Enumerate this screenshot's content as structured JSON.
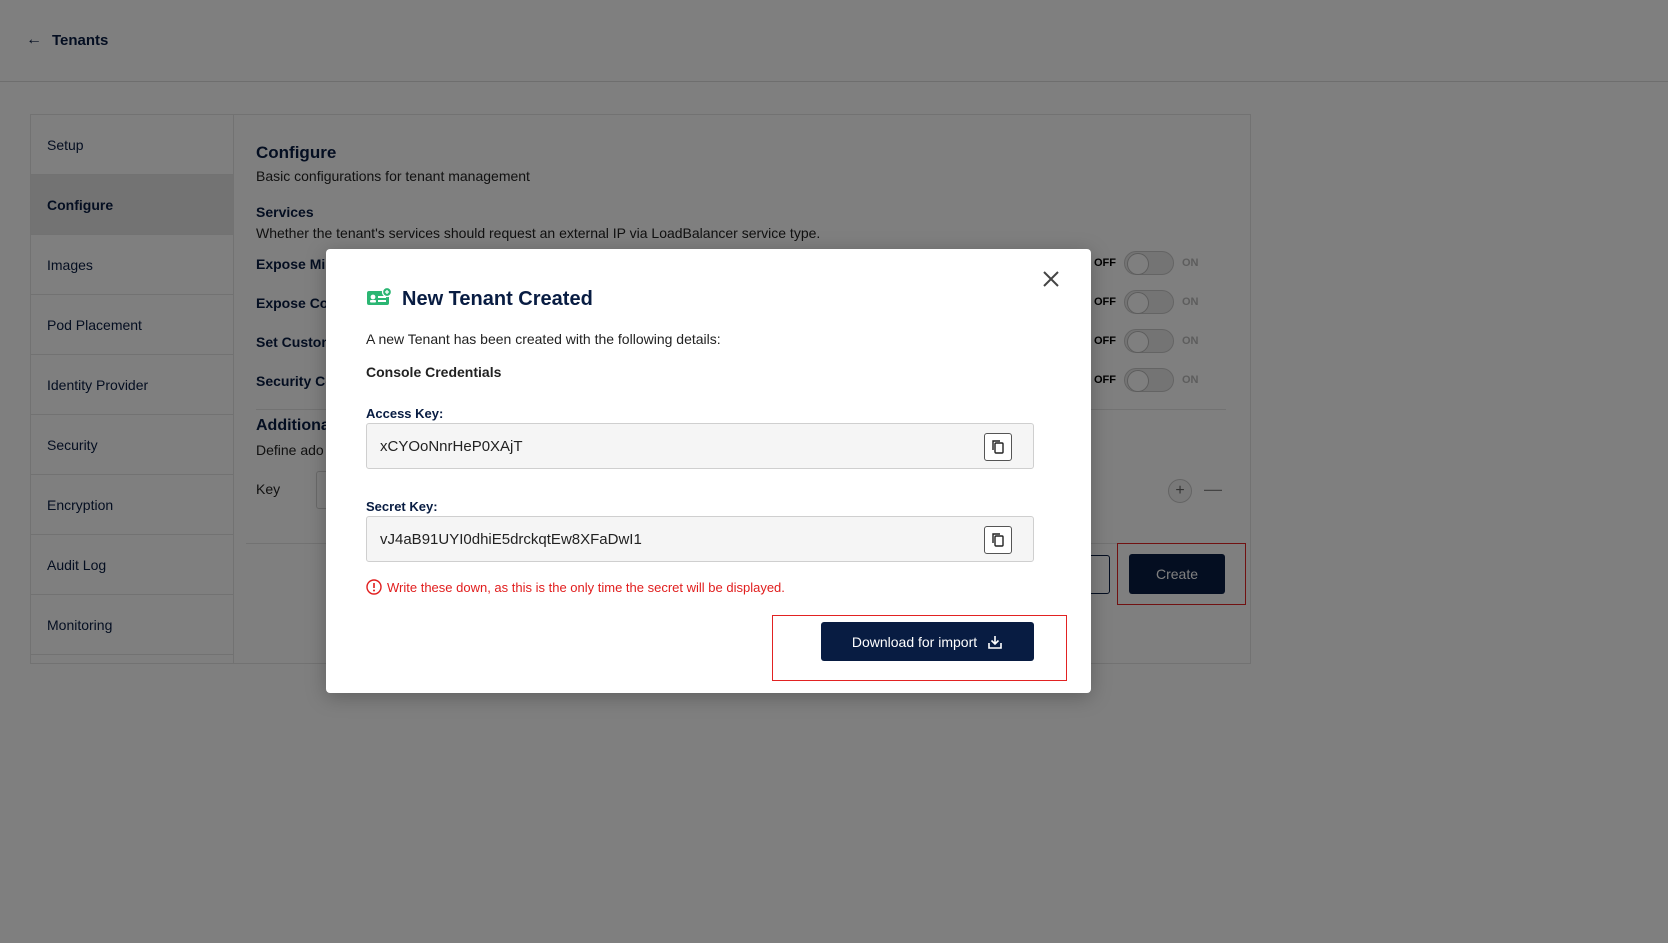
{
  "header": {
    "back_label": "Tenants"
  },
  "sidebar": {
    "items": [
      {
        "label": "Setup"
      },
      {
        "label": "Configure"
      },
      {
        "label": "Images"
      },
      {
        "label": "Pod Placement"
      },
      {
        "label": "Identity Provider"
      },
      {
        "label": "Security"
      },
      {
        "label": "Encryption"
      },
      {
        "label": "Audit Log"
      },
      {
        "label": "Monitoring"
      }
    ],
    "active": "Configure"
  },
  "configure": {
    "title": "Configure",
    "subtitle": "Basic configurations for tenant management",
    "services_title": "Services",
    "services_desc": "Whether the tenant's services should request an external IP via LoadBalancer service type.",
    "rows": [
      {
        "label": "Expose Mi",
        "off": "OFF",
        "on": "ON",
        "state": "off"
      },
      {
        "label": "Expose Co",
        "off": "OFF",
        "on": "ON",
        "state": "off"
      },
      {
        "label": "Set Custom",
        "off": "OFF",
        "on": "ON",
        "state": "off"
      },
      {
        "label": "Security Co",
        "off": "OFF",
        "on": "ON",
        "state": "off"
      }
    ],
    "additional_title": "Additiona",
    "additional_desc": "Define ado",
    "key_label": "Key",
    "plus": "+",
    "minus": "—",
    "create_label": "Create"
  },
  "modal": {
    "title": "New Tenant Created",
    "description": "A new Tenant has been created with the following details:",
    "section": "Console Credentials",
    "access_key_label": "Access Key:",
    "access_key_value": "xCYOoNnrHeP0XAjT",
    "secret_key_label": "Secret Key:",
    "secret_key_value": "vJ4aB91UYI0dhiE5drckqtEw8XFaDwI1",
    "warning": "Write these down, as this is the only time the secret will be displayed.",
    "download_label": "Download for import"
  },
  "colors": {
    "primary": "#081c42",
    "accent_green": "#2bb673",
    "warning_red": "#e11d1d"
  },
  "icons": [
    "back-arrow-icon",
    "tenant-id-card-icon",
    "close-icon",
    "copy-icon",
    "alert-circle-icon",
    "download-icon"
  ]
}
